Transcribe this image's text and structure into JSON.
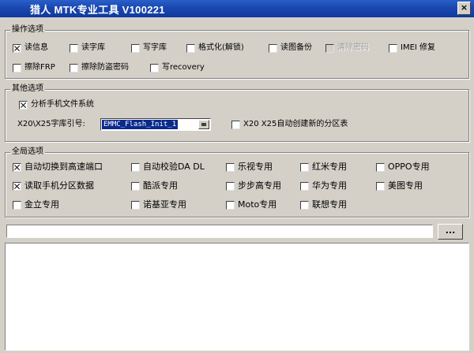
{
  "window": {
    "title": "猎人 MTK专业工具 V100221",
    "close_glyph": "×"
  },
  "ops": {
    "title": "操作选项",
    "items": [
      {
        "label": "读信息",
        "checked": true,
        "enabled": true
      },
      {
        "label": "读字库",
        "checked": false,
        "enabled": true
      },
      {
        "label": "写字库",
        "checked": false,
        "enabled": true
      },
      {
        "label": "格式化(解锁)",
        "checked": false,
        "enabled": true
      },
      {
        "label": "读图备份",
        "checked": false,
        "enabled": true
      },
      {
        "label": "清除密码",
        "checked": false,
        "enabled": false
      },
      {
        "label": "IMEI 修复",
        "checked": false,
        "enabled": true
      },
      {
        "label": "擦除FRP",
        "checked": false,
        "enabled": true
      },
      {
        "label": "擦除防盗密码",
        "checked": false,
        "enabled": true
      },
      {
        "label": "写recovery",
        "checked": false,
        "enabled": true
      }
    ]
  },
  "other": {
    "title": "其他选项",
    "analyze_fs": {
      "label": "分析手机文件系统",
      "checked": true
    },
    "x20_label": "X20\\X25字库引号:",
    "combo_value": "EMMC_Flash_Init_1",
    "auto_partition": {
      "label": "X20 X25自动创建新的分区表",
      "checked": false
    }
  },
  "global": {
    "title": "全局选项",
    "items": [
      {
        "label": "自动切换到高速端口",
        "checked": true
      },
      {
        "label": "自动校验DA DL",
        "checked": false
      },
      {
        "label": "乐视专用",
        "checked": false
      },
      {
        "label": "红米专用",
        "checked": false
      },
      {
        "label": "OPPO专用",
        "checked": false
      },
      {
        "label": "读取手机分区数据",
        "checked": true
      },
      {
        "label": "酷派专用",
        "checked": false
      },
      {
        "label": "步步高专用",
        "checked": false
      },
      {
        "label": "华为专用",
        "checked": false
      },
      {
        "label": "美图专用",
        "checked": false
      },
      {
        "label": "金立专用",
        "checked": false
      },
      {
        "label": "诺基亚专用",
        "checked": false
      },
      {
        "label": "Moto专用",
        "checked": false
      },
      {
        "label": "联想专用",
        "checked": false
      }
    ]
  },
  "path": {
    "value": ""
  },
  "browse": {
    "label": "..."
  },
  "log": {
    "text": ""
  }
}
